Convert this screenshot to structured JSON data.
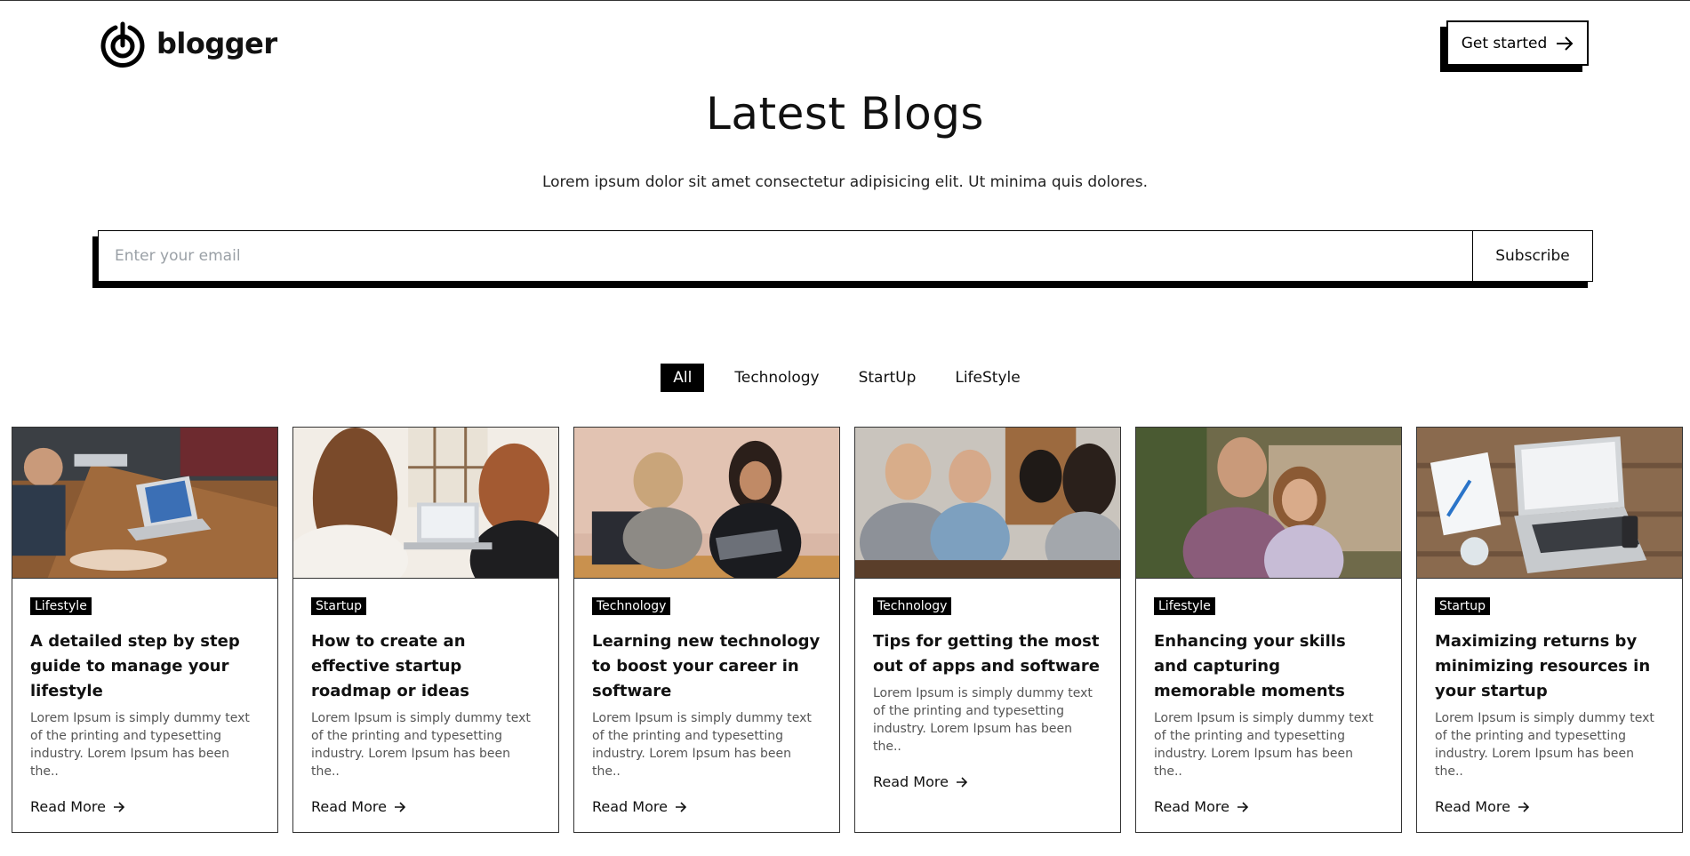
{
  "brand": {
    "name": "blogger",
    "icon": "power-target-logo-icon"
  },
  "header": {
    "cta_label": "Get started",
    "cta_icon": "arrow-right-icon"
  },
  "hero": {
    "title": "Latest Blogs",
    "subtitle": "Lorem ipsum dolor sit amet consectetur adipisicing elit. Ut minima quis dolores."
  },
  "subscribe": {
    "placeholder": "Enter your email",
    "button_label": "Subscribe"
  },
  "filters": {
    "items": [
      {
        "label": "All",
        "active": true
      },
      {
        "label": "Technology",
        "active": false
      },
      {
        "label": "StartUp",
        "active": false
      },
      {
        "label": "LifeStyle",
        "active": false
      }
    ]
  },
  "colors": {
    "primary": "#000000",
    "background": "#ffffff",
    "muted_text": "#555555",
    "placeholder": "#9aa0a6"
  },
  "cards": [
    {
      "tag": "Lifestyle",
      "title": "A detailed step by step guide to manage your lifestyle",
      "excerpt": "Lorem Ipsum is simply dummy text of the printing and typesetting industry. Lorem Ipsum has been the..",
      "read_more": "Read More",
      "image": "team-meeting-laptop-photo"
    },
    {
      "tag": "Startup",
      "title": "How to create an effective startup roadmap or ideas",
      "excerpt": "Lorem Ipsum is simply dummy text of the printing and typesetting industry. Lorem Ipsum has been the..",
      "read_more": "Read More",
      "image": "two-women-laptop-photo"
    },
    {
      "tag": "Technology",
      "title": "Learning new technology to boost your career in software",
      "excerpt": "Lorem Ipsum is simply dummy text of the printing and typesetting industry. Lorem Ipsum has been the..",
      "read_more": "Read More",
      "image": "women-tablet-meeting-photo"
    },
    {
      "tag": "Technology",
      "title": "Tips for getting the most out of apps and software",
      "excerpt": "Lorem Ipsum is simply dummy text of the printing and typesetting industry. Lorem Ipsum has been the..",
      "read_more": "Read More",
      "image": "friends-phones-table-photo"
    },
    {
      "tag": "Lifestyle",
      "title": "Enhancing your skills and capturing memorable moments",
      "excerpt": "Lorem Ipsum is simply dummy text of the printing and typesetting industry. Lorem Ipsum has been the..",
      "read_more": "Read More",
      "image": "couple-portrait-photo"
    },
    {
      "tag": "Startup",
      "title": "Maximizing returns by minimizing resources in your startup",
      "excerpt": "Lorem Ipsum is simply dummy text of the printing and typesetting industry. Lorem Ipsum has been the..",
      "read_more": "Read More",
      "image": "laptop-desk-flatlay-photo"
    }
  ]
}
